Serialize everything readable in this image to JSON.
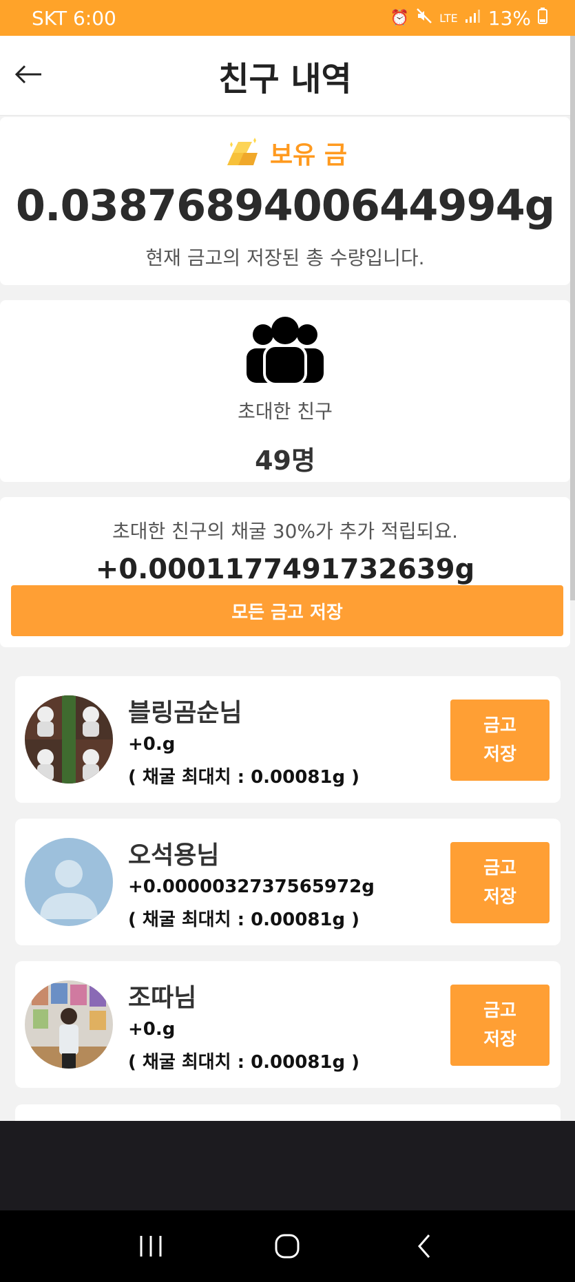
{
  "status_bar": {
    "carrier_time": "SKT 6:00",
    "network": "LTE",
    "battery": "13%",
    "icons": [
      "alarm-icon",
      "mute-icon",
      "lte-icon",
      "signal-icon",
      "battery-icon"
    ]
  },
  "header": {
    "title": "친구 내역",
    "back_icon": "back-arrow-icon"
  },
  "gold": {
    "label": "보유 금",
    "amount": "0.0387689400644994g",
    "description": "현재 금고의 저장된 총 수량입니다."
  },
  "invite": {
    "label": "초대한 친구",
    "count": "49명"
  },
  "bonus": {
    "description": "초대한 친구의 채굴 30%가 추가 적립되요.",
    "amount": "+0.0001177491732639g",
    "save_all_label": "모든 금고 저장"
  },
  "friends": [
    {
      "name": "블링곰순님",
      "gold": "+0.g",
      "max": "( 채굴 최대치 : 0.00081g )",
      "save_label": "금고\n저장",
      "avatar": "photo"
    },
    {
      "name": "오석용님",
      "gold": "+0.0000032737565972g",
      "max": "( 채굴 최대치 : 0.00081g )",
      "save_label": "금고\n저장",
      "avatar": "default"
    },
    {
      "name": "조따님",
      "gold": "+0.g",
      "max": "( 채굴 최대치 : 0.00081g )",
      "save_label": "금고\n저장",
      "avatar": "photo"
    }
  ],
  "colors": {
    "accent": "#ff9f34",
    "status_bar": "#ffa329",
    "gold_label": "#ff9a1f"
  }
}
